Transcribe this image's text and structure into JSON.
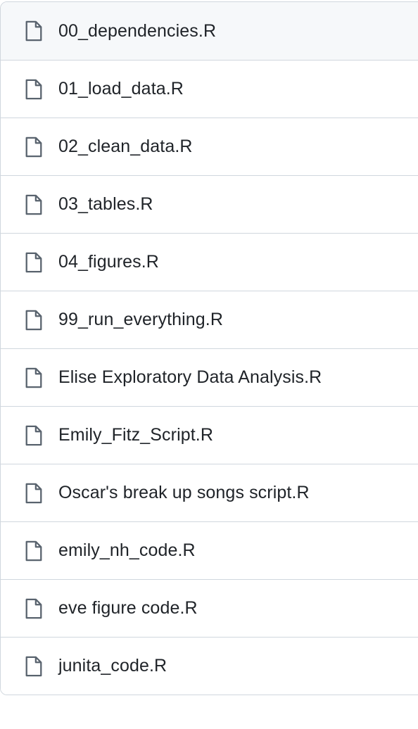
{
  "files": [
    {
      "name": "00_dependencies.R",
      "icon": "file-icon"
    },
    {
      "name": "01_load_data.R",
      "icon": "file-icon"
    },
    {
      "name": "02_clean_data.R",
      "icon": "file-icon"
    },
    {
      "name": "03_tables.R",
      "icon": "file-icon"
    },
    {
      "name": "04_figures.R",
      "icon": "file-icon"
    },
    {
      "name": "99_run_everything.R",
      "icon": "file-icon"
    },
    {
      "name": "Elise Exploratory Data Analysis.R",
      "icon": "file-icon"
    },
    {
      "name": "Emily_Fitz_Script.R",
      "icon": "file-icon"
    },
    {
      "name": "Oscar's break up songs script.R",
      "icon": "file-icon"
    },
    {
      "name": "emily_nh_code.R",
      "icon": "file-icon"
    },
    {
      "name": "eve figure code.R",
      "icon": "file-icon"
    },
    {
      "name": "junita_code.R",
      "icon": "file-icon"
    }
  ],
  "colors": {
    "border": "#d0d7de",
    "hover_row": "#f6f8fa",
    "text": "#1f2328",
    "icon": "#59636e"
  }
}
